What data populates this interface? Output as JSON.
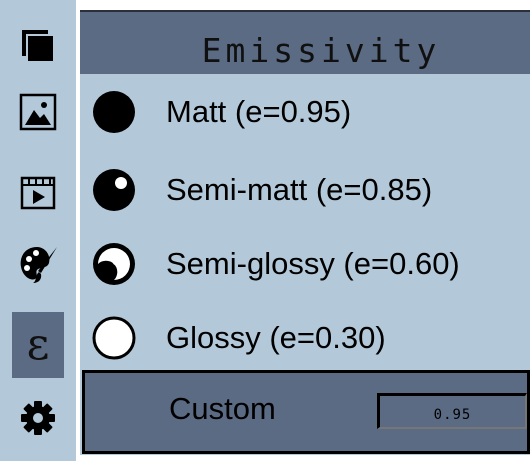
{
  "sidebar": {
    "items": [
      {
        "icon": "layers-icon",
        "active": false
      },
      {
        "icon": "image-icon",
        "active": false
      },
      {
        "icon": "video-frame-icon",
        "active": false
      },
      {
        "icon": "palette-icon",
        "active": false
      },
      {
        "icon": "epsilon-icon",
        "active": true,
        "glyph": "ε"
      },
      {
        "icon": "gear-icon",
        "active": false
      }
    ]
  },
  "panel": {
    "title": "Emissivity",
    "options": [
      {
        "label": "Matt (e=0.95)",
        "icon": "matt-sphere-icon"
      },
      {
        "label": "Semi-matt (e=0.85)",
        "icon": "semi-matt-sphere-icon"
      },
      {
        "label": "Semi-glossy (e=0.60)",
        "icon": "semi-glossy-sphere-icon"
      },
      {
        "label": "Glossy (e=0.30)",
        "icon": "glossy-sphere-icon"
      }
    ],
    "custom": {
      "label": "Custom",
      "value": "0.95"
    }
  },
  "colors": {
    "panel_bg": "#b3c9d9",
    "header_bg": "#5b6b84",
    "text": "#000000"
  }
}
